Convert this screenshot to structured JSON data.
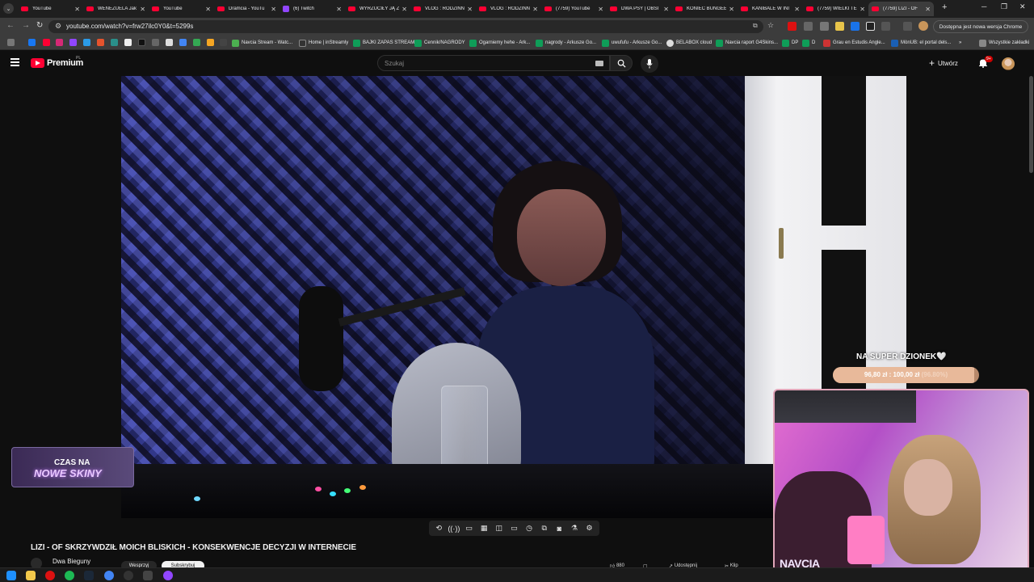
{
  "browser": {
    "tabs": [
      {
        "label": "YouTube",
        "icon": "youtube-icon",
        "active": false
      },
      {
        "label": "WENEZUELA Jak",
        "icon": "youtube-icon",
        "active": false
      },
      {
        "label": "YouTube",
        "icon": "youtube-icon",
        "active": false
      },
      {
        "label": "Dramcia - YouTu",
        "icon": "youtube-icon",
        "active": false
      },
      {
        "label": "(6) Twitch",
        "icon": "twitch-icon",
        "active": false
      },
      {
        "label": "WYRZUCIŁY JĄ Z",
        "icon": "youtube-icon",
        "active": false
      },
      {
        "label": "VLOG : RODZINN",
        "icon": "youtube-icon",
        "active": false
      },
      {
        "label": "VLOG : RODZINN",
        "icon": "youtube-icon",
        "active": false
      },
      {
        "label": "(7759) YouTube",
        "icon": "youtube-icon",
        "active": false
      },
      {
        "label": "DWA PSY | OBSI",
        "icon": "youtube-icon",
        "active": false
      },
      {
        "label": "KONIEC BUNGEE",
        "icon": "youtube-icon",
        "active": false
      },
      {
        "label": "KANIBALE W INI",
        "icon": "youtube-icon",
        "active": false
      },
      {
        "label": "(7759) WIELKI TE",
        "icon": "youtube-icon",
        "active": false
      },
      {
        "label": "(7759) LIZI - OF",
        "icon": "youtube-icon",
        "active": true
      }
    ],
    "url": "youtube.com/watch?v=frw27ilc0Y0&t=5299s",
    "update_notice": "Dostępna jest nowa wersja Chrome",
    "bookmarks": [
      "Navcia Stream - Watc...",
      "Home | inStreamly",
      "BAJKI ZAPAS STREAM",
      "Cennik/NAGRODY",
      "Ogarniemy hehe - Ark...",
      "nagrody - Arkusze Go...",
      "uwufufu - Arkusze Go...",
      "BELABOX cloud",
      "Navcia raport G4Skins...",
      "DP",
      "D",
      "Grau en Estudis Angle...",
      "MònUB: el portal dels..."
    ],
    "all_bookmarks": "Wszystkie zakładki"
  },
  "youtube": {
    "brand": "Premium",
    "region": "PL",
    "search_placeholder": "Szukaj",
    "create_label": "Utwórz",
    "notif_badge": "9+",
    "video_title": "LIZI - OF SKRZYWDZIŁ MOICH BLISKICH - KONSEKWENCJE DECYZJI W INTERNECIE",
    "channel": "Dwa Bieguny",
    "join_label": "Wesprzyj",
    "subscribe_label": "Subskrybuj",
    "likes": "880",
    "share_label": "Udostępnij",
    "clip_label": "Klip"
  },
  "overlay": {
    "goal_title": "NA SUPER DZIONEK🤍",
    "goal_current": "96,80 zł",
    "goal_target": "100,00 zł",
    "goal_percent": "(96.80%)",
    "goal_fraction": 0.968,
    "promo_line1": "CZAS NA",
    "promo_line2": "NOWE SKINY",
    "cam_brand": "NAVCIA"
  },
  "toolbar_icons": [
    "loop-icon",
    "cast-icon",
    "captions-icon",
    "clapper-icon",
    "pip-icon",
    "theater-icon",
    "speed-icon",
    "miniplayer-icon",
    "screenshot-icon",
    "filter-icon",
    "settings-icon"
  ],
  "colors": {
    "yt_red": "#ff0033",
    "twitch_purple": "#9146ff",
    "goal_bar": "#e8b99a",
    "cam_border": "#e1a6b9"
  }
}
